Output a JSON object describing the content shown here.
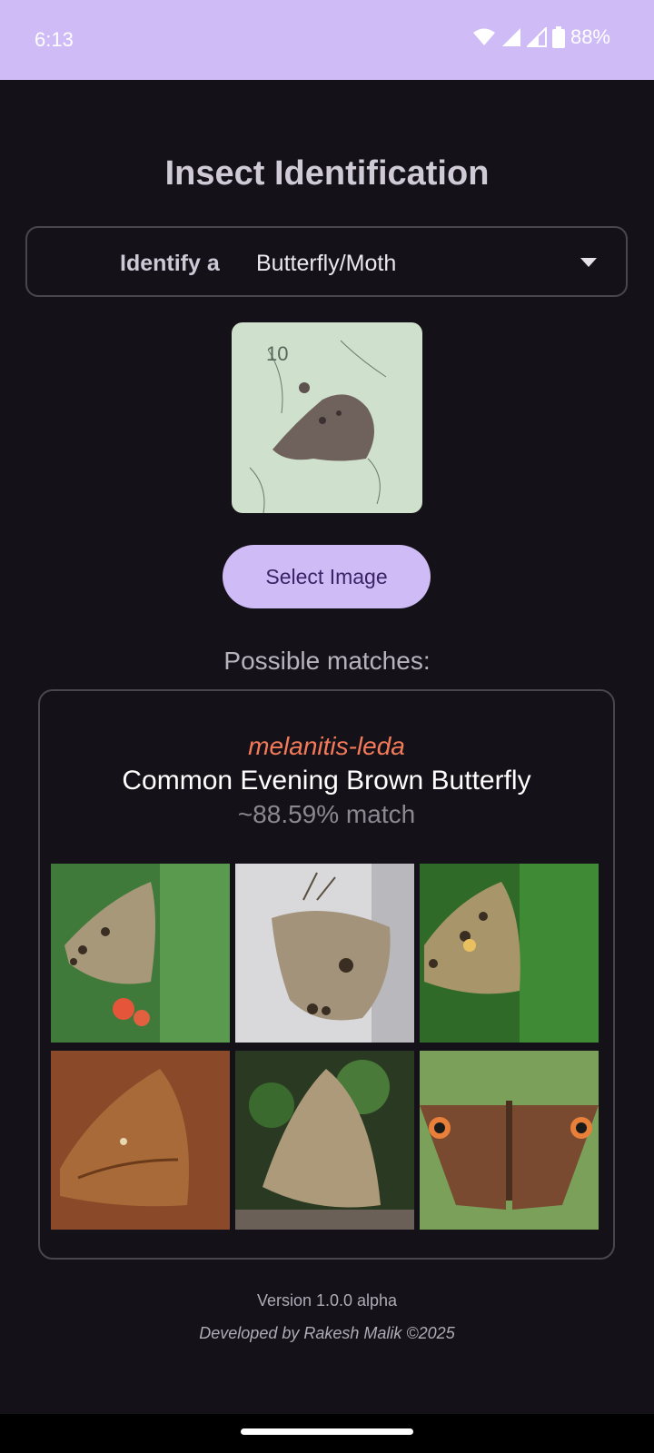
{
  "status_bar": {
    "time": "6:13",
    "battery": "88%",
    "icons": [
      "wifi-icon",
      "signal-icon",
      "signal-icon",
      "battery-icon"
    ]
  },
  "page": {
    "title": "Insect Identification"
  },
  "identify": {
    "label": "Identify a",
    "selected": "Butterfly/Moth",
    "icon": "dropdown-arrow-icon"
  },
  "actions": {
    "select_image": "Select Image"
  },
  "results": {
    "heading": "Possible matches:",
    "top_match": {
      "species": "melanitis-leda",
      "common_name": "Common Evening Brown Butterfly",
      "confidence": "~88.59% match"
    }
  },
  "footer": {
    "version": "Version 1.0.0 alpha",
    "developer": "Developed by Rakesh Malik ©2025"
  },
  "colors": {
    "accent": "#cfbcf6",
    "background": "#141218",
    "species": "#f47a5a"
  }
}
